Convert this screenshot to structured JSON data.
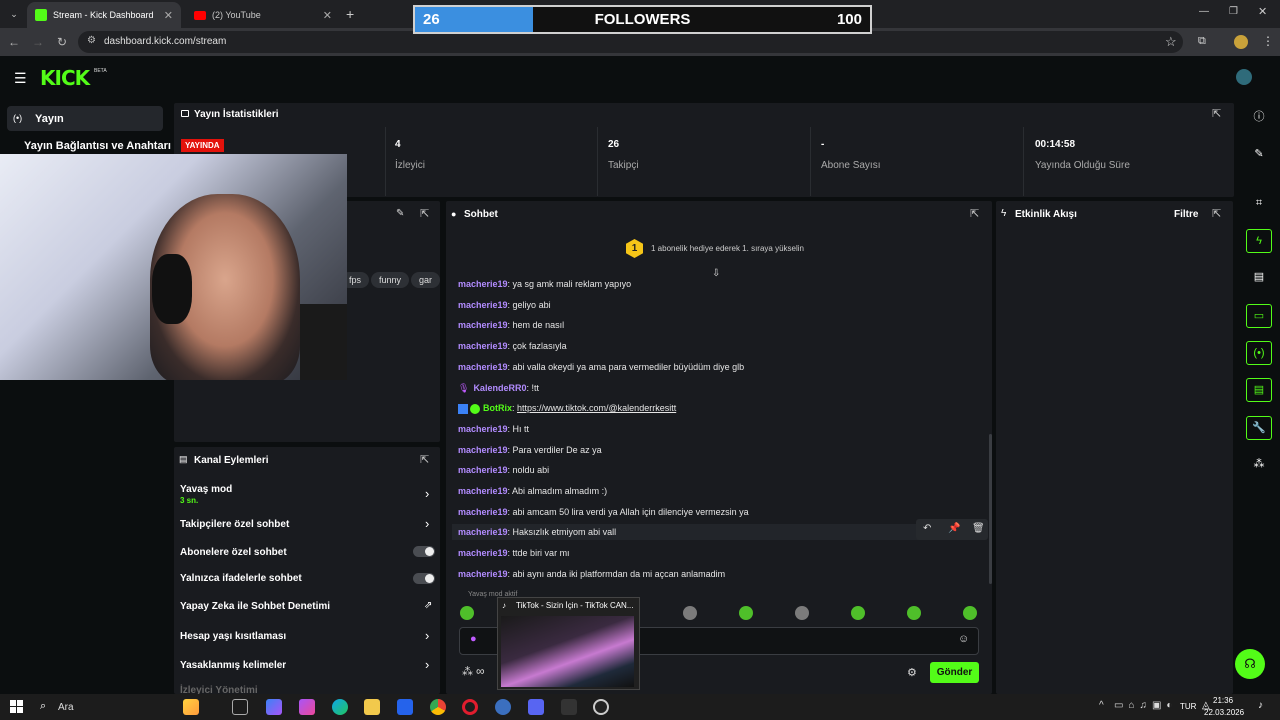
{
  "browser": {
    "tabs": [
      {
        "label": "Stream - Kick Dashboard",
        "active": true
      },
      {
        "label": "(2) YouTube",
        "active": false
      }
    ],
    "url": "dashboard.kick.com/stream"
  },
  "followers_overlay": {
    "current": "26",
    "label": "FOLLOWERS",
    "goal": "100",
    "progress": 0.26
  },
  "brand": {
    "logo": "KICK",
    "beta": "BETA",
    "accent": "#53fc18"
  },
  "sidebar": {
    "items": [
      {
        "label": "Yayın",
        "icon": "broadcast-icon"
      },
      {
        "label": "Yayın Bağlantısı ve Anahtarı"
      }
    ]
  },
  "stats": {
    "title": "Yayın İstatistikleri",
    "live_badge": "YAYINDA",
    "items": [
      {
        "value": "4",
        "label": "İzleyici"
      },
      {
        "value": "26",
        "label": "Takipçi"
      },
      {
        "value": "-",
        "label": "Abone Sayısı"
      },
      {
        "value": "00:14:58",
        "label": "Yayında Olduğu Süre"
      }
    ]
  },
  "stream_info": {
    "tags": [
      "fps",
      "funny",
      "gar"
    ]
  },
  "chat": {
    "title": "Sohbet",
    "gift_rank": "1",
    "gift_banner": "1 abonelik hediye ederek 1. sıraya yükselin",
    "messages": [
      {
        "user": "macherie19",
        "text": ": ya sg amk mali reklam yapıyo"
      },
      {
        "user": "macherie19",
        "text": ": geliyo abi"
      },
      {
        "user": "macherie19",
        "text": ": hem de nasıl"
      },
      {
        "user": "macherie19",
        "text": ": çok fazlasıyla"
      },
      {
        "user": "macherie19",
        "text": ": abi valla okeydi ya ama para vermediler büyüdüm diye glb"
      },
      {
        "user": "KalendeRR0",
        "text": ": !tt"
      },
      {
        "user": "BotRix",
        "text": ": ",
        "link": "https://www.tiktok.com/@kalenderrkesitt"
      },
      {
        "user": "macherie19",
        "text": ": Hı tt"
      },
      {
        "user": "macherie19",
        "text": ": Para verdiler De az ya"
      },
      {
        "user": "macherie19",
        "text": ": noldu abi"
      },
      {
        "user": "macherie19",
        "text": ": Abi almadım almadım :)"
      },
      {
        "user": "macherie19",
        "text": ": abi amcam 50 lira verdi ya Allah için dilenciye vermezsin ya"
      },
      {
        "user": "macherie19",
        "text": ": Haksızlık etmiyom abi vall"
      },
      {
        "user": "macherie19",
        "text": ": ttde biri var mı"
      },
      {
        "user": "macherie19",
        "text": ": abi aynı anda iki platformdan da mi açcan anlamadim"
      }
    ],
    "slow_mode_note": "Yavaş mod aktif",
    "send_label": "Gönder"
  },
  "activity": {
    "title": "Etkinlik Akışı",
    "filter_label": "Filtre"
  },
  "channel_actions": {
    "title": "Kanal Eylemleri",
    "items": [
      {
        "label": "Yavaş mod",
        "sub": "3 sn.",
        "control": "chevron"
      },
      {
        "label": "Takipçilere özel sohbet",
        "control": "chevron"
      },
      {
        "label": "Abonelere özel sohbet",
        "control": "toggle"
      },
      {
        "label": "Yalnızca ifadelerle sohbet",
        "control": "toggle"
      },
      {
        "label": "Yapay Zeka ile Sohbet Denetimi",
        "control": "external"
      },
      {
        "label": "Hesap yaşı kısıtlaması",
        "control": "chevron"
      },
      {
        "label": "Yasaklanmış kelimeler",
        "control": "chevron"
      },
      {
        "label": "İzleyici Yönetimi",
        "control": "none"
      }
    ]
  },
  "tiktok_preview": {
    "title": "TikTok - Sizin İçin - TikTok CAN..."
  },
  "taskbar": {
    "search_label": "Ara",
    "lang": "TUR",
    "time": "21:36",
    "date": "22.03.2026"
  }
}
